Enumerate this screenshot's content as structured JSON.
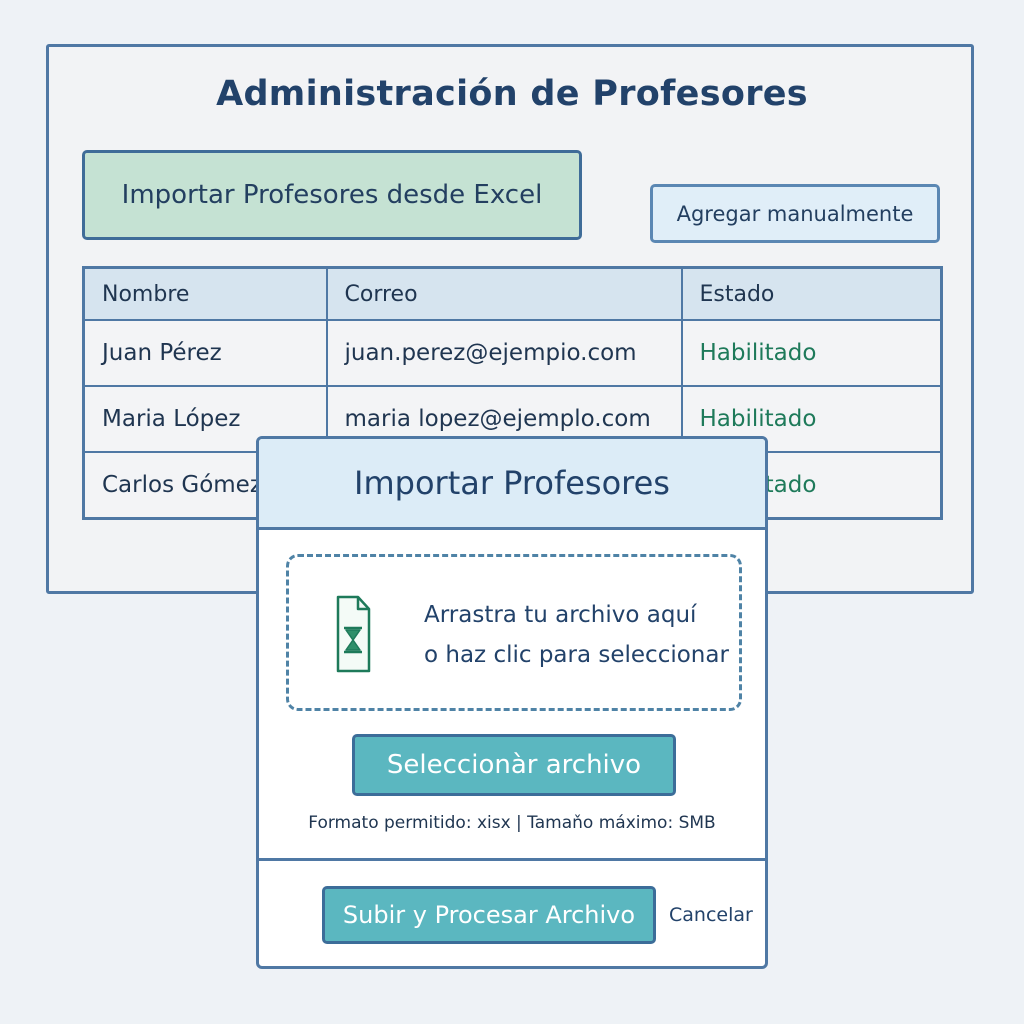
{
  "admin": {
    "title": "Administración de Profesores",
    "import_button": "Importar Profesores desde Excel",
    "add_manual_button": "Agregar manualmente",
    "table": {
      "columns": [
        "Nombre",
        "Correo",
        "Estado"
      ],
      "rows": [
        {
          "name": "Juan Pérez",
          "email": "juan.perez@ejempio.com",
          "status": "Habilitado"
        },
        {
          "name": "Maria López",
          "email": "maria lopez@ejemplo.com",
          "status": "Habilitado"
        },
        {
          "name": "Carlos Gómez",
          "email": "",
          "status": "Habilitado"
        }
      ]
    }
  },
  "modal": {
    "title": "Importar Profesores",
    "dropzone": {
      "icon": "excel-file-icon",
      "line1": "Arrastra tu archivo aquí",
      "line2": "o haz clic para seleccionar"
    },
    "select_button": "Seleccionàr archivo",
    "format_info": "Formato permitido:  xisx  |  Tamaňo máximo: SMB",
    "upload_button": "Subir y Procesar Archivo",
    "cancel": "Cancelar"
  },
  "colors": {
    "background": "#eef2f6",
    "border": "#4f78a4",
    "import_button_bg": "#c5e2d3",
    "primary_button_bg": "#5bb7c0",
    "status_enabled": "#1e7a5a",
    "header_bg": "#dcecf7"
  }
}
